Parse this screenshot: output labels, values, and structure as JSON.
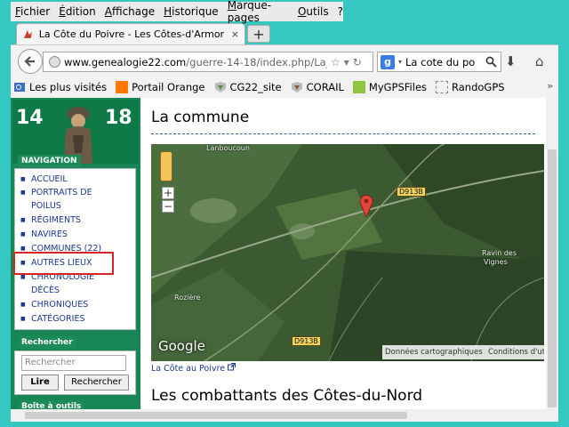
{
  "menu": [
    "Fichier",
    "Édition",
    "Affichage",
    "Historique",
    "Marque-pages",
    "Outils",
    "?"
  ],
  "tab": {
    "title": "La Côte du Poivre - Les Côtes-d'Armor d...",
    "close": "×",
    "new_tab": "+"
  },
  "address": {
    "url_host": "www.genealogie22.com",
    "url_path": "/guerre-14-18/index.php/La_C"
  },
  "search": {
    "value": "La cote du po",
    "engine_letter": "g"
  },
  "bookmarks": [
    "Les plus visités",
    "Portail Orange",
    "CG22_site",
    "CORAIL",
    "MyGPSFiles",
    "RandoGPS"
  ],
  "bookmarks_more": "»",
  "logo": {
    "left": "14",
    "right": "18"
  },
  "navigation": {
    "header": "NAVIGATION",
    "items": [
      "ACCUEIL",
      "PORTRAITS DE POILUS",
      "RÉGIMENTS",
      "NAVIRES",
      "COMMUNES (22)",
      "AUTRES LIEUX",
      "CHRONOLOGIE DÉCÈS",
      "CHRONIQUES",
      "CATÉGORIES"
    ]
  },
  "search_box": {
    "header": "Rechercher",
    "placeholder": "Rechercher",
    "btn_go": "Lire",
    "btn_search": "Rechercher"
  },
  "toolbox": {
    "header": "Boîte à outils"
  },
  "main": {
    "heading": "La commune",
    "map": {
      "zoom_in": "+",
      "zoom_out": "−",
      "labels": [
        "Lanboucoun",
        "D913B",
        "Ravin des",
        "Vignes",
        "Rozière",
        "D913B"
      ],
      "google": "Google",
      "attrib_left": "Données cartographiques",
      "attrib_right": "Conditions d'uti"
    },
    "map_link": "La Côte au Poivre",
    "heading2": "Les combattants des Côtes-du-Nord"
  },
  "colors": {
    "sidebar": "#158654",
    "link": "#1a3a8f",
    "highlight": "#d62428"
  }
}
